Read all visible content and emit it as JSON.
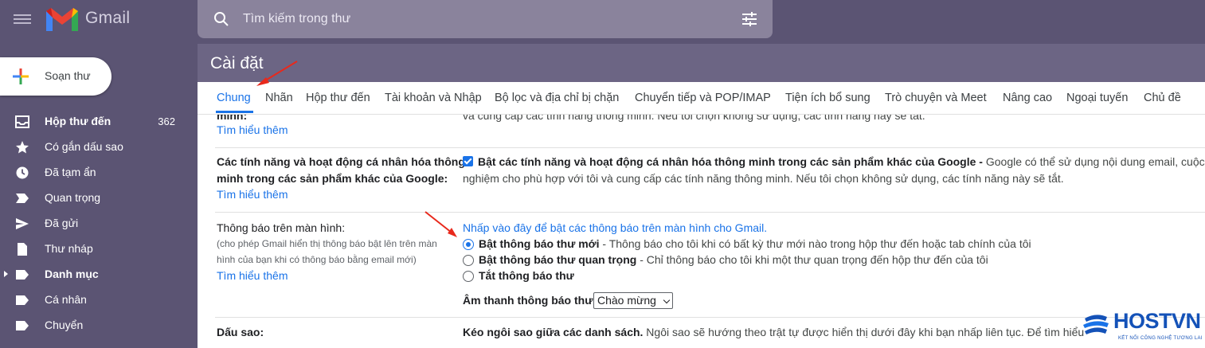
{
  "app": {
    "name": "Gmail"
  },
  "search": {
    "placeholder": "Tìm kiếm trong thư"
  },
  "compose": {
    "label": "Soạn thư"
  },
  "sidebar": {
    "items": [
      {
        "label": "Hộp thư đến",
        "count": "362",
        "icon": "inbox-icon",
        "bold": true
      },
      {
        "label": "Có gắn dấu sao",
        "icon": "star-icon"
      },
      {
        "label": "Đã tạm ẩn",
        "icon": "clock-icon"
      },
      {
        "label": "Quan trọng",
        "icon": "important-icon"
      },
      {
        "label": "Đã gửi",
        "icon": "send-icon"
      },
      {
        "label": "Thư nháp",
        "icon": "draft-icon"
      },
      {
        "label": "Danh mục",
        "icon": "label-icon",
        "bold": true
      },
      {
        "label": "Cá nhân",
        "icon": "label-icon"
      },
      {
        "label": "Chuyển",
        "icon": "label-icon"
      }
    ]
  },
  "page": {
    "title": "Cài đặt"
  },
  "tabs": [
    "Chung",
    "Nhãn",
    "Hộp thư đến",
    "Tài khoản và Nhập",
    "Bộ lọc và địa chỉ bị chặn",
    "Chuyển tiếp và POP/IMAP",
    "Tiện ích bổ sung",
    "Trò chuyện và Meet",
    "Nâng cao",
    "Ngoại tuyến",
    "Chủ đề"
  ],
  "settings": {
    "top": {
      "label_partial": "minh:",
      "text_partial": "và cung cấp các tính năng thông minh. Nếu tôi chọn không sử dụng, các tính năng này sẽ tắt.",
      "learn_more": "Tìm hiểu thêm"
    },
    "personalization": {
      "label_line1": "Các tính năng và hoạt động cá nhân hóa thông",
      "label_line2": "minh trong các sản phẩm khác của Google:",
      "learn_more": "Tìm hiểu thêm",
      "checkbox_bold": "Bật các tính năng và hoạt động cá nhân hóa thông minh trong các sản phẩm khác của Google -",
      "checkbox_text": " Google có thể sử dụng nội dung email, cuộc trò",
      "checkbox_text2": "nghiệm cho phù hợp với tôi và cung cấp các tính năng thông minh. Nếu tôi chọn không sử dụng, các tính năng này sẽ tắt."
    },
    "notifications": {
      "label": "Thông báo trên màn hình:",
      "note_line1": "(cho phép Gmail hiển thị thông báo bật lên trên màn",
      "note_line2": "hình của bạn khi có thông báo bằng email mới)",
      "learn_more": "Tìm hiểu thêm",
      "enable_link": "Nhấp vào đây để bật các thông báo trên màn hình cho Gmail.",
      "options": [
        {
          "bold": "Bật thông báo thư mới",
          "text": " - Thông báo cho tôi khi có bất kỳ thư mới nào trong hộp thư đến hoặc tab chính của tôi",
          "selected": true
        },
        {
          "bold": "Bật thông báo thư quan trọng",
          "text": " - Chỉ thông báo cho tôi khi một thư quan trọng đến hộp thư đến của tôi",
          "selected": false
        },
        {
          "bold": "Tắt thông báo thư",
          "text": "",
          "selected": false
        }
      ],
      "sound_label": "Âm thanh thông báo thư:",
      "sound_value": "Chào mừng"
    },
    "stars": {
      "label": "Dấu sao:",
      "bold": "Kéo ngôi sao giữa các danh sách.",
      "text": " Ngôi sao sẽ hướng theo trật tự được hiển thị dưới đây khi bạn nhấp liên tục. Để tìm hiểu"
    }
  },
  "watermark": {
    "name": "HOSTVN",
    "tagline": "KẾT NỐI CÔNG NGHỆ TƯƠNG LAI"
  },
  "colors": {
    "accent": "#1a73e8",
    "theme": "#5b5473",
    "annotation": "#e8291c"
  }
}
